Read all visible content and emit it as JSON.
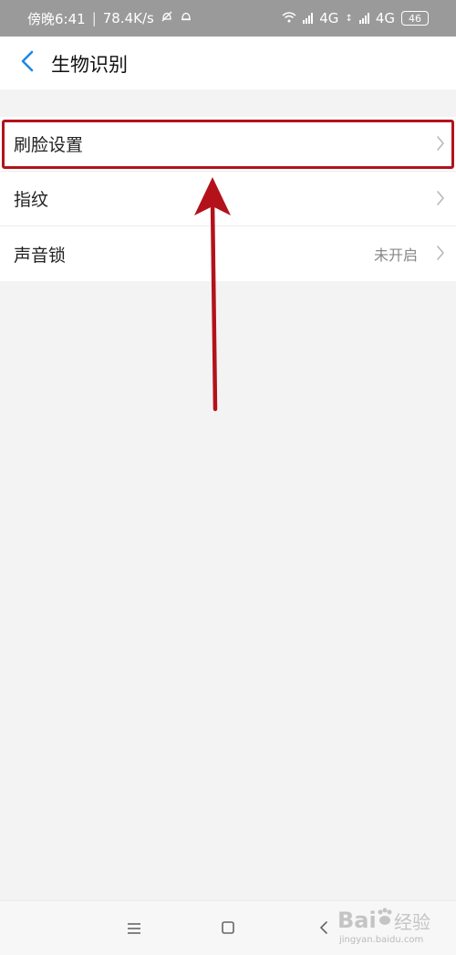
{
  "status_bar": {
    "time": "傍晚6:41",
    "separator": "|",
    "network_speed": "78.4K/s",
    "mute_icon": "bell-off-icon",
    "alarm_icon": "bell-icon",
    "wifi_icon": "wifi-icon",
    "sim1_network": "4G",
    "sim2_network": "4G",
    "battery_level": "46"
  },
  "header": {
    "back_icon": "chevron-left-icon",
    "title": "生物识别",
    "accent_color": "#1e88e5"
  },
  "settings": {
    "items": [
      {
        "label": "刷脸设置",
        "value": "",
        "highlighted": true
      },
      {
        "label": "指纹",
        "value": ""
      },
      {
        "label": "声音锁",
        "value": "未开启"
      }
    ]
  },
  "annotation": {
    "color": "#b3121b",
    "shape": "arrow-up"
  },
  "nav_bar": {
    "menu_icon": "menu-icon",
    "home_icon": "square-icon",
    "back_icon": "chevron-left-icon"
  },
  "watermark": {
    "brand": "Bai",
    "suffix": "经验",
    "url": "jingyan.baidu.com"
  }
}
